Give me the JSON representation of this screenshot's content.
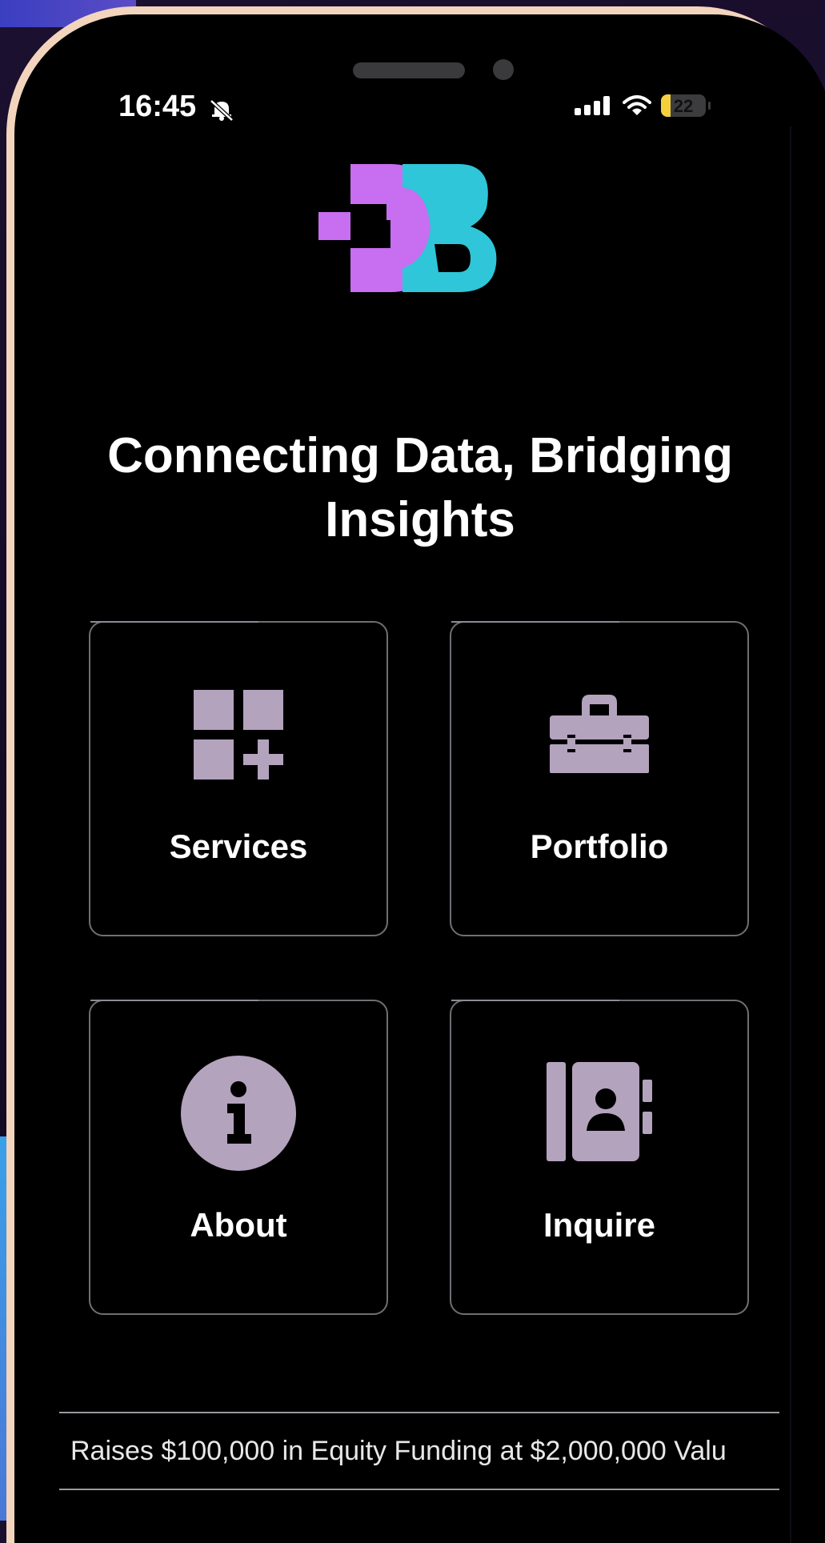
{
  "status_bar": {
    "time": "16:45",
    "battery": "22",
    "battery_level": 0.22,
    "icons": [
      "bell-slash-icon",
      "cellular-signal-icon",
      "wifi-icon",
      "battery-icon"
    ]
  },
  "logo": {
    "text": "DB",
    "colors": {
      "left": "#c86ef0",
      "right": "#2ec6d8"
    }
  },
  "headline": {
    "line1": "Connecting Data, Bridging",
    "line2": "Insights"
  },
  "cards": [
    {
      "label": "Services",
      "icon": "grid-plus-icon"
    },
    {
      "label": "Portfolio",
      "icon": "toolbox-icon"
    },
    {
      "label": "About",
      "icon": "info-circle-icon"
    },
    {
      "label": "Inquire",
      "icon": "contact-book-icon"
    }
  ],
  "ticker": {
    "text": "Raises $100,000 in Equity Funding at $2,000,000 Valu"
  },
  "colors": {
    "icon": "#b3a3bd",
    "background": "#000000",
    "text": "#ffffff"
  }
}
